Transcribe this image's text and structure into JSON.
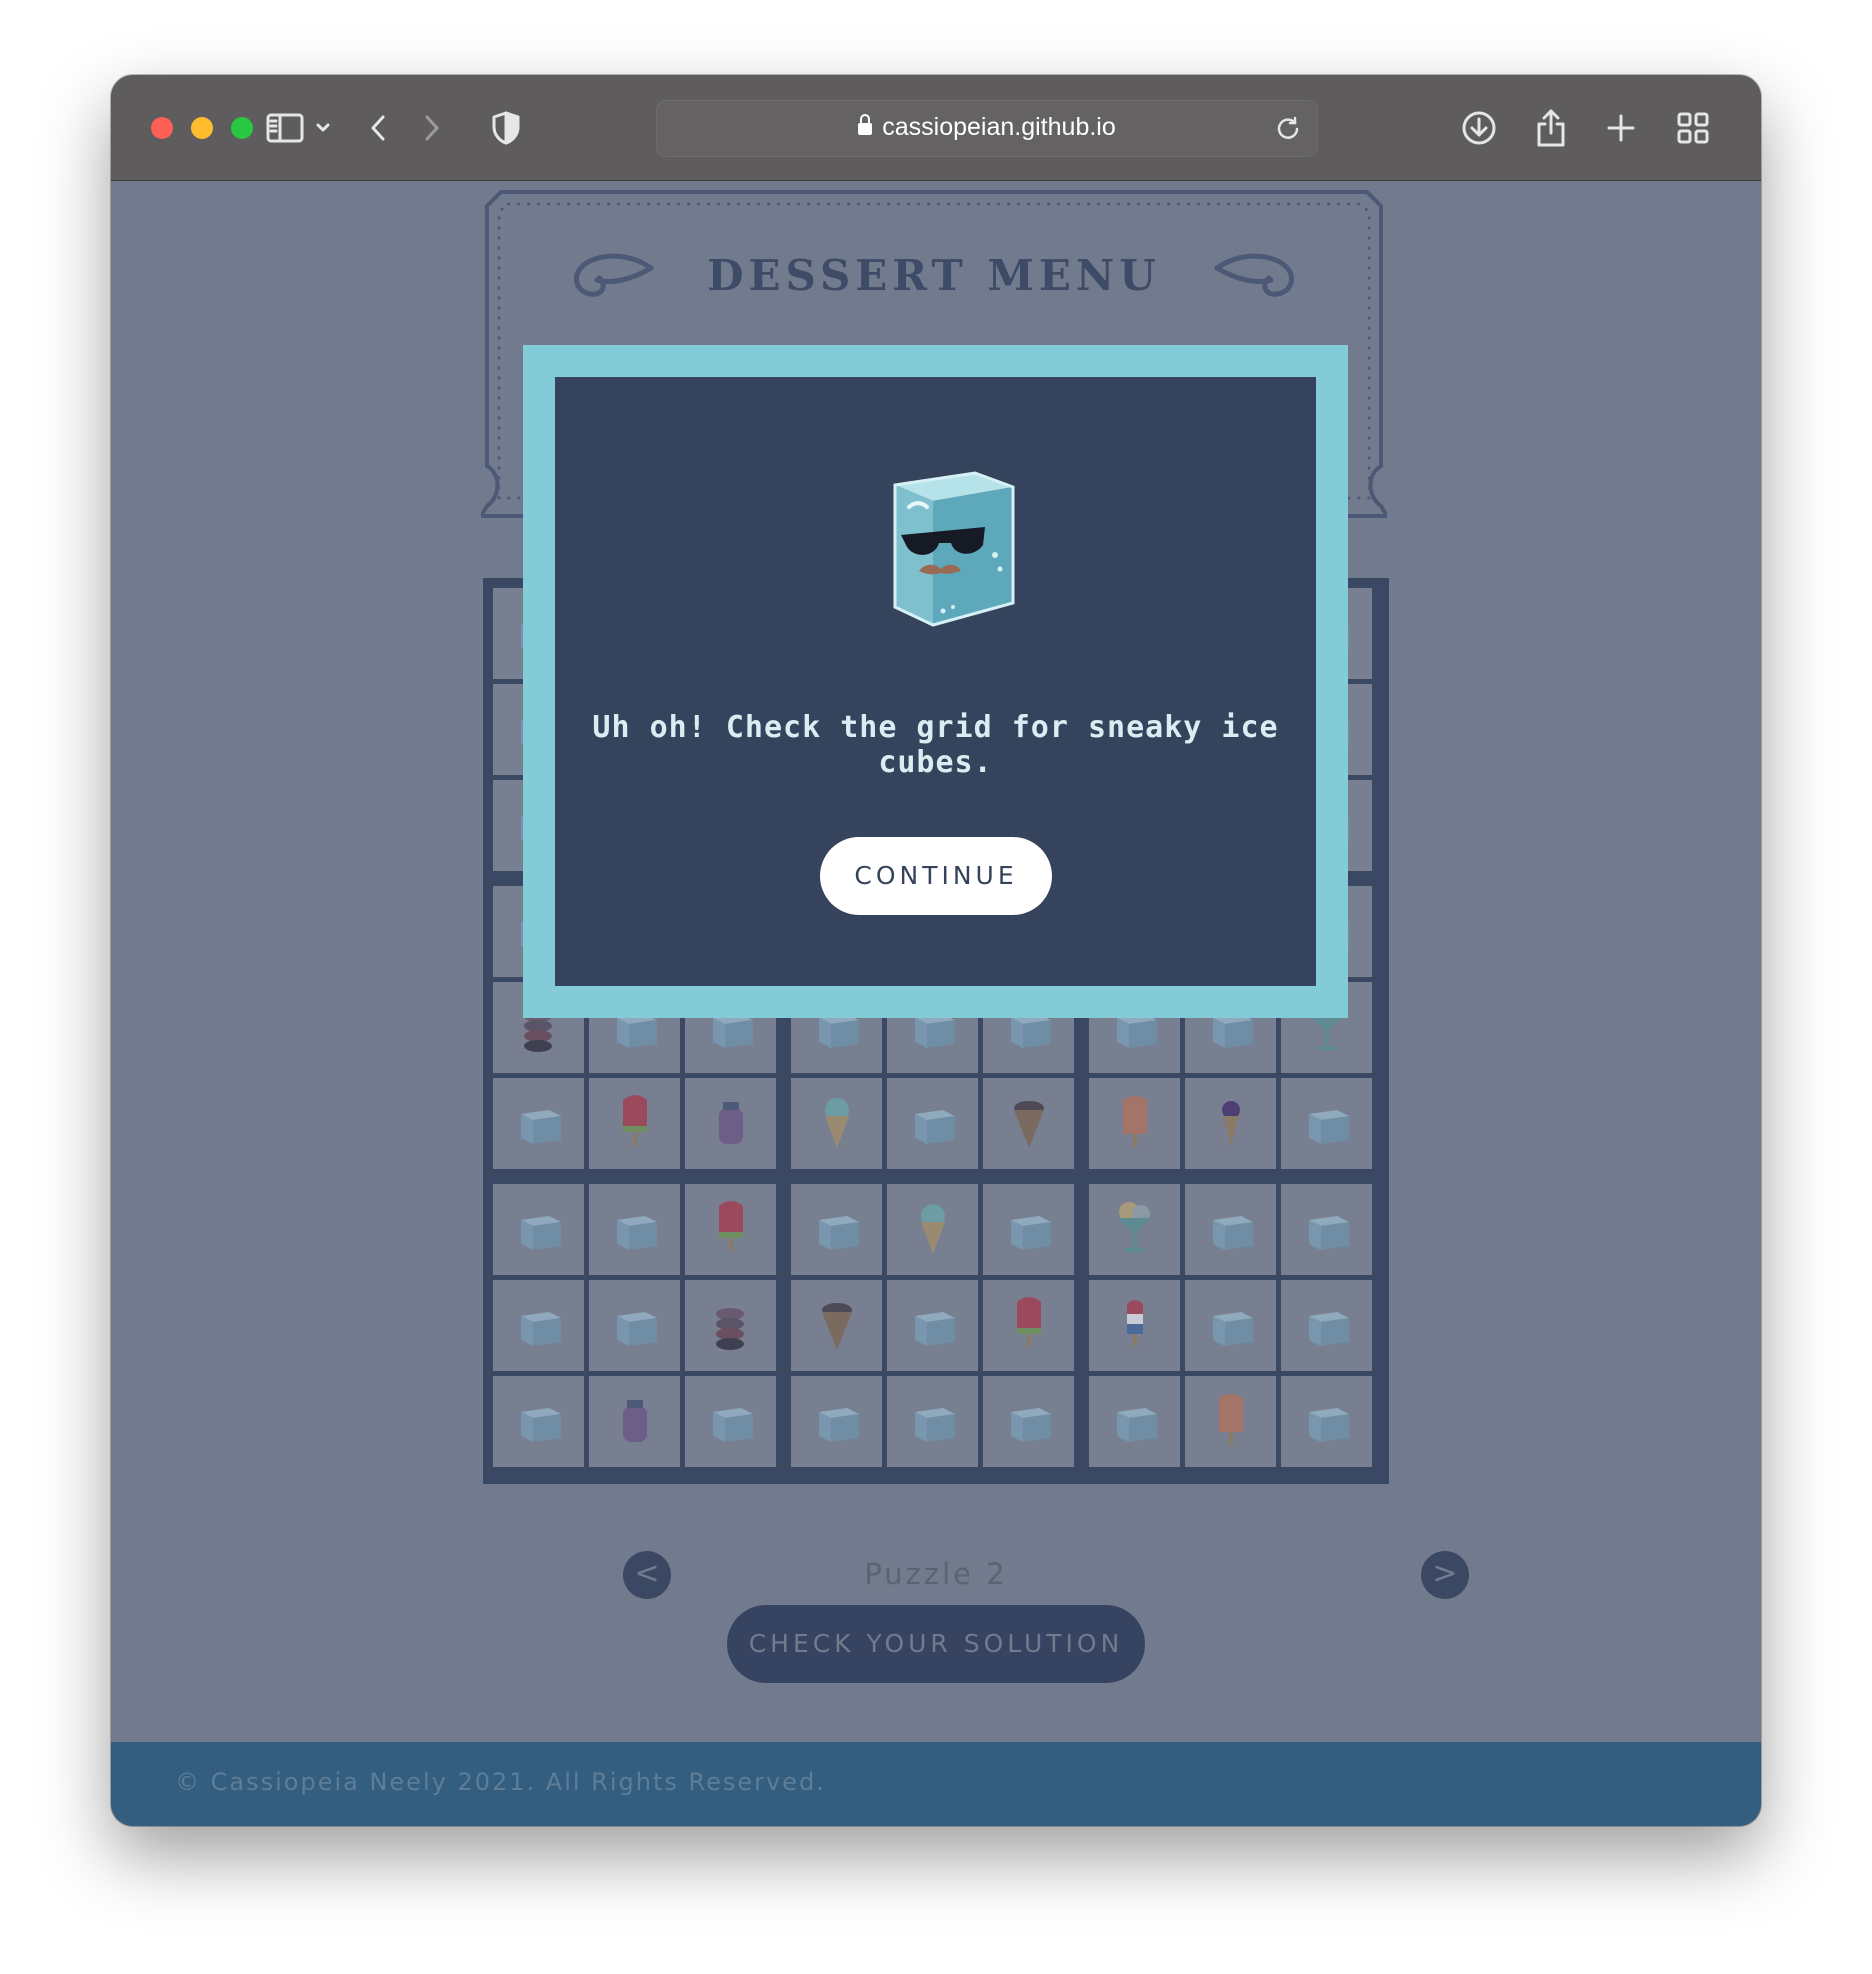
{
  "browser": {
    "url": "cassiopeian.github.io"
  },
  "page": {
    "title": "DESSERT MENU",
    "puzzle_label": "Puzzle 2",
    "prev_label": "<",
    "next_label": ">",
    "check_label": "CHECK YOUR SOLUTION",
    "footer": "© Cassiopeia Neely 2021. All Rights Reserved."
  },
  "modal": {
    "message": "Uh oh! Check the grid for sneaky ice cubes.",
    "continue_label": "CONTINUE",
    "image": "sunglasses-ice-cube-icon"
  },
  "grid": {
    "visible_rows": [
      [
        "macaron",
        "ice",
        "ice",
        "ice",
        "ice",
        "ice",
        "ice",
        "ice",
        "sundae"
      ],
      [
        "ice",
        "watermelon-popsicle",
        "smoothie",
        "mint-cone",
        "ice",
        "chocolate-cone",
        "orange-popsicle",
        "berry-cone",
        "ice"
      ],
      [
        "ice",
        "ice",
        "watermelon-popsicle",
        "ice",
        "mint-cone",
        "ice",
        "sundae",
        "ice",
        "ice"
      ],
      [
        "ice",
        "ice",
        "macaron",
        "chocolate-cone",
        "ice",
        "watermelon-popsicle",
        "rocket-popsicle",
        "ice",
        "ice"
      ],
      [
        "ice",
        "smoothie",
        "ice",
        "ice",
        "ice",
        "ice",
        "ice",
        "orange-popsicle",
        "ice"
      ]
    ]
  },
  "colors": {
    "overlay_bg": "#727b8d",
    "modal_border": "#83ccd7",
    "modal_bg": "#36435d",
    "grid_line": "#3b4863",
    "footer_bg": "#335e80"
  }
}
